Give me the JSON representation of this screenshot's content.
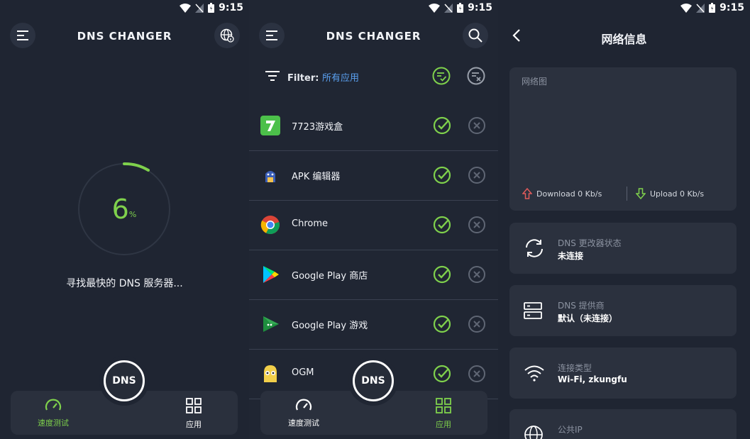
{
  "status_bar": {
    "time": "9:15"
  },
  "screen1": {
    "title": "DNS CHANGER",
    "progress": {
      "value": "6",
      "unit": "%"
    },
    "message": "寻找最快的 DNS 服务器...",
    "fab_label": "DNS",
    "nav": {
      "speed_test": "速度测试",
      "apps": "应用"
    }
  },
  "screen2": {
    "title": "DNS CHANGER",
    "filter_label": "Filter:",
    "filter_value": "所有应用",
    "apps": [
      {
        "name": "7723游戏盒"
      },
      {
        "name": "APK 编辑器"
      },
      {
        "name": "Chrome"
      },
      {
        "name": "Google Play 商店"
      },
      {
        "name": "Google Play 游戏"
      },
      {
        "name": "OGM"
      }
    ],
    "fab_label": "DNS",
    "nav": {
      "speed_test": "速度测试",
      "apps": "应用"
    }
  },
  "screen3": {
    "title": "网络信息",
    "graph_title": "网络图",
    "download": "Download 0 Kb/s",
    "upload": "Upload 0 Kb/s",
    "dns_status_label": "DNS 更改器状态",
    "dns_status_value": "未连接",
    "dns_provider_label": "DNS 提供商",
    "dns_provider_value": "默认（未连接）",
    "conn_type_label": "连接类型",
    "conn_type_value": "Wi-Fi, zkungfu",
    "public_ip_label": "公共IP"
  },
  "colors": {
    "accent_green": "#7fd14c",
    "filter_blue": "#5aa0f0",
    "bg": "#1f2532",
    "card": "#2b313e"
  }
}
